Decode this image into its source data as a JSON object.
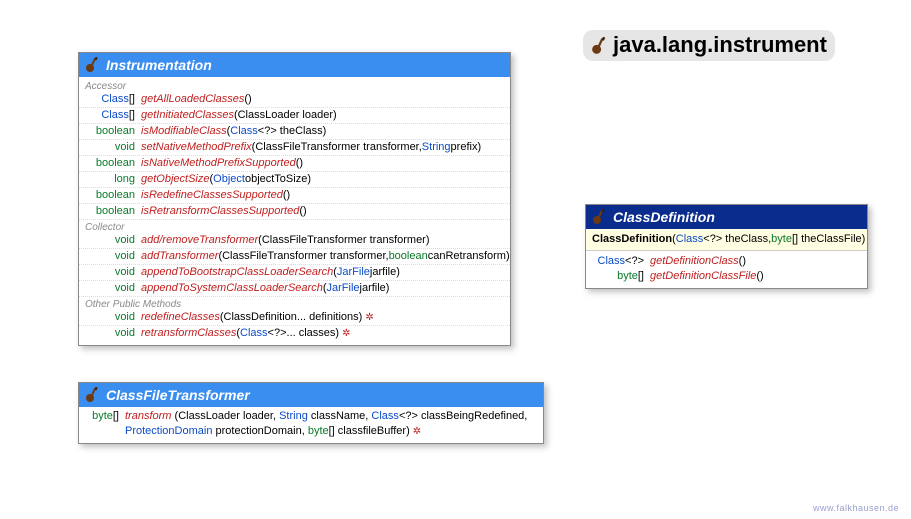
{
  "package_title": "java.lang.instrument",
  "footer": "www.falkhausen.de",
  "colors": {
    "interface_header": "#3a8ef0",
    "class_header": "#0a2c8c",
    "keyword": "#0a7a2a",
    "type": "#0b4bc6",
    "method": "#c02020"
  },
  "instrumentation": {
    "title": "Instrumentation",
    "sections": {
      "accessor": "Accessor",
      "collector": "Collector",
      "other": "Other Public Methods"
    },
    "accessor_rows": [
      {
        "ret_type": "Class",
        "ret_suffix": "[]",
        "name": "getAllLoadedClasses",
        "params": " ()"
      },
      {
        "ret_type": "Class",
        "ret_suffix": "[]",
        "name": "getInitiatedClasses",
        "params": " (ClassLoader loader)"
      },
      {
        "ret_kw": "boolean",
        "name": "isModifiableClass",
        "params_pre": " (",
        "param_type": "Class",
        "param_mid": "<?> theClass)"
      },
      {
        "ret_kw": "void",
        "name": "setNativeMethodPrefix",
        "params_pre": " (ClassFileTransformer transformer, ",
        "param_type": "String",
        "param_post": " prefix)"
      },
      {
        "ret_kw": "boolean",
        "name": "isNativeMethodPrefixSupported",
        "params": " ()"
      },
      {
        "ret_kw": "long",
        "name": "getObjectSize",
        "params_pre": " (",
        "param_type": "Object",
        "param_post": " objectToSize)"
      },
      {
        "ret_kw": "boolean",
        "name": "isRedefineClassesSupported",
        "params": " ()"
      },
      {
        "ret_kw": "boolean",
        "name": "isRetransformClassesSupported",
        "params": " ()"
      }
    ],
    "collector_rows": [
      {
        "ret_kw": "void",
        "name": "add/removeTransformer",
        "params": " (ClassFileTransformer transformer)"
      },
      {
        "ret_kw": "void",
        "name": "addTransformer",
        "params_pre": " (ClassFileTransformer transformer, ",
        "param_kw": "boolean",
        "param_post": " canRetransform)"
      },
      {
        "ret_kw": "void",
        "name": "appendToBootstrapClassLoaderSearch",
        "params_pre": " (",
        "param_type": "JarFile",
        "param_post": " jarfile)"
      },
      {
        "ret_kw": "void",
        "name": "appendToSystemClassLoaderSearch",
        "params_pre": " (",
        "param_type": "JarFile",
        "param_post": " jarfile)"
      }
    ],
    "other_rows": [
      {
        "ret_kw": "void",
        "name": "redefineClasses",
        "params": " (ClassDefinition... definitions)",
        "throws": "✲"
      },
      {
        "ret_kw": "void",
        "name": "retransformClasses",
        "params_pre": " (",
        "param_type": "Class",
        "param_mid": " <?>... classes)",
        "throws": "✲"
      }
    ]
  },
  "classfiletransformer": {
    "title": "ClassFileTransformer",
    "row": {
      "ret_kw": "byte",
      "ret_suffix": "[]",
      "name": "transform",
      "p1": " (ClassLoader loader, ",
      "p2_type": "String",
      "p2_post": " className, ",
      "p3_type": "Class",
      "p3_post": "<?> classBeingRedefined, ",
      "p4_type": "ProtectionDomain",
      "p4_post": " protectionDomain, ",
      "p5_kw": "byte",
      "p5_post": "[] classfileBuffer)",
      "throws": "✲"
    }
  },
  "classdefinition": {
    "title": "ClassDefinition",
    "ctor": {
      "name": "ClassDefinition",
      "p_pre": " (",
      "p_type": "Class",
      "p_mid": "<?> theClass, ",
      "p_kw": "byte",
      "p_post": "[] theClassFile)"
    },
    "rows": [
      {
        "ret_type": "Class",
        "ret_suffix": "<?>",
        "name": "getDefinitionClass",
        "params": " ()"
      },
      {
        "ret_kw": "byte",
        "ret_suffix": "[]",
        "name": "getDefinitionClassFile",
        "params": " ()"
      }
    ]
  }
}
